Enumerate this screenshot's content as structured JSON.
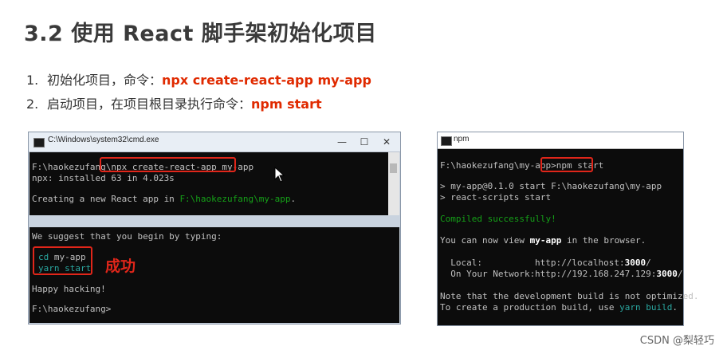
{
  "title": "3.2 使用 React 脚手架初始化项目",
  "steps": [
    {
      "num": "1.",
      "text": "初始化项目，命令：",
      "cmd": "npx create-react-app  my-app"
    },
    {
      "num": "2.",
      "text": "启动项目，在项目根目录执行命令：",
      "cmd": "npm start"
    }
  ],
  "window1": {
    "title": "C:\\Windows\\system32\\cmd.exe",
    "controls": {
      "minimize": "—",
      "maximize": "☐",
      "close": "✕"
    },
    "top_lines": {
      "prompt": "F:\\haokezufang\\",
      "command": "npx create-react-app my-app",
      "installed": "npx: installed 63 in 4.023s",
      "creating_prefix": "Creating a new React app in ",
      "creating_path": "F:\\haokezufang\\my-app",
      "creating_suffix": "."
    },
    "bottom_lines": {
      "suggest": "We suggest that you begin by typing:",
      "cd_kw": "cd",
      "cd_arg": " my-app",
      "yarn_start": "yarn start",
      "happy": "Happy hacking!",
      "final_prompt": "F:\\haokezufang>"
    }
  },
  "success_label": "成功",
  "window2": {
    "title": "npm",
    "prompt": "F:\\haokezufang\\my-app>",
    "command": "npm start",
    "line_start": "> my-app@0.1.0 start F:\\haokezufang\\my-app",
    "line_scripts": "> react-scripts start",
    "compiled": "Compiled successfully!",
    "view_pre": "You can now view ",
    "view_app": "my-app",
    "view_post": " in the browser.",
    "local_label": "  Local:",
    "local_url_pre": "http://localhost:",
    "local_port": "3000",
    "local_url_post": "/",
    "network_label": "  On Your Network:",
    "network_url_pre": "http://192.168.247.129:",
    "network_port": "3000",
    "network_url_post": "/",
    "note1": "Note that the development build is not optimized.",
    "note2_pre": "To create a production build, use ",
    "note2_cmd": "yarn build",
    "note2_post": "."
  },
  "watermark": "CSDN @梨轻巧",
  "colors": {
    "accent_red": "#e02a00",
    "box_red": "#e0261a",
    "terminal_green": "#15a018",
    "terminal_teal": "#2aa7a0"
  }
}
